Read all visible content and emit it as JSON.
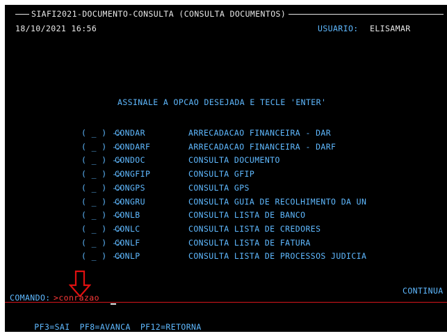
{
  "header": {
    "title": "SIAFI2021-DOCUMENTO-CONSULTA (CONSULTA DOCUMENTOS)",
    "datetime": "18/10/2021 16:56",
    "user_label": "USUARIO:",
    "user_name": "ELISAMAR"
  },
  "prompt": "ASSINALE A OPCAO DESEJADA E TECLE 'ENTER'",
  "menu": [
    {
      "select": "( _ ) ->",
      "code": "CONDAR",
      "description": "ARRECADACAO FINANCEIRA - DAR"
    },
    {
      "select": "( _ ) ->",
      "code": "CONDARF",
      "description": "ARRECADACAO FINANCEIRA - DARF"
    },
    {
      "select": "( _ ) ->",
      "code": "CONDOC",
      "description": "CONSULTA DOCUMENTO"
    },
    {
      "select": "( _ ) ->",
      "code": "CONGFIP",
      "description": "CONSULTA GFIP"
    },
    {
      "select": "( _ ) ->",
      "code": "CONGPS",
      "description": "CONSULTA GPS"
    },
    {
      "select": "( _ ) ->",
      "code": "CONGRU",
      "description": "CONSULTA GUIA DE RECOLHIMENTO DA UN"
    },
    {
      "select": "( _ ) ->",
      "code": "CONLB",
      "description": "CONSULTA LISTA DE BANCO"
    },
    {
      "select": "( _ ) ->",
      "code": "CONLC",
      "description": "CONSULTA LISTA DE CREDORES"
    },
    {
      "select": "( _ ) ->",
      "code": "CONLF",
      "description": "CONSULTA LISTA DE FATURA"
    },
    {
      "select": "( _ ) ->",
      "code": "CONLP",
      "description": "CONSULTA LISTA DE PROCESSOS JUDICIA"
    }
  ],
  "continue_label": "CONTINUA",
  "command": {
    "label": "COMANDO:",
    "value": ">conrazao"
  },
  "pf_keys": [
    "PF3=SAI",
    "PF8=AVANCA",
    "PF12=RETORNA"
  ],
  "colors": {
    "background": "#000000",
    "text_white": "#e8e8e8",
    "text_cyan": "#5fb9ff",
    "command_red": "#ff3a3a",
    "arrow_red": "#e01010"
  },
  "icons": {
    "annotation": "red-down-arrow-icon"
  }
}
